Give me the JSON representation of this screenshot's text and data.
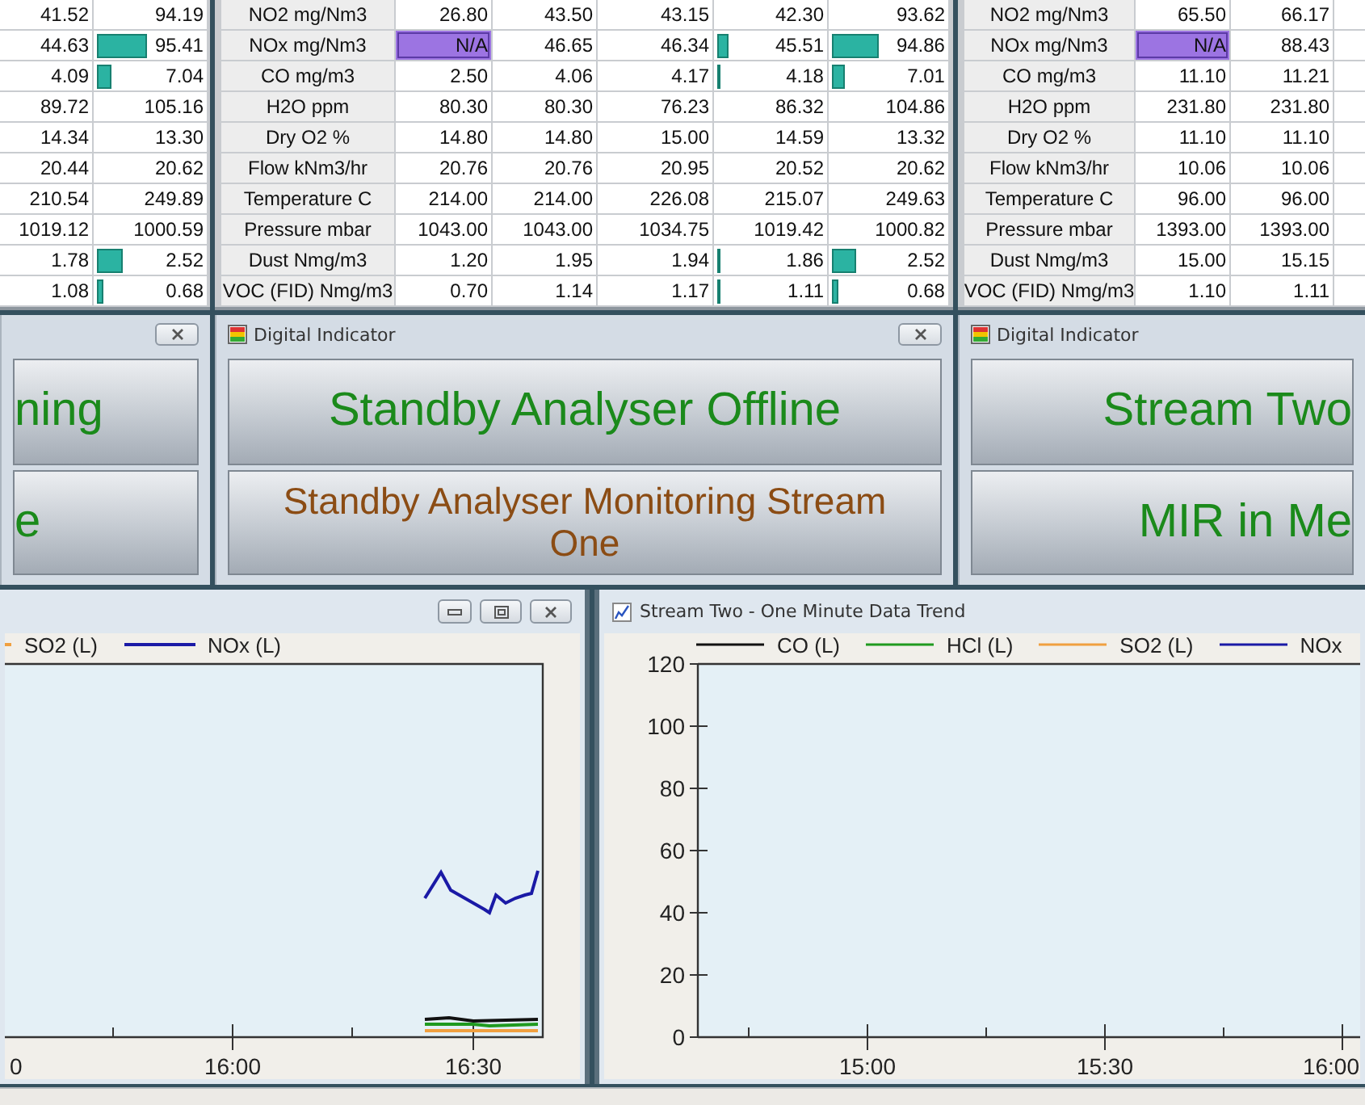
{
  "stream_tables": [
    {
      "rows": [
        {
          "cells": [
            {
              "text": "41.52",
              "flagged": false
            },
            {
              "text": "94.19",
              "flagged": false
            }
          ]
        },
        {
          "cells": [
            {
              "text": "44.63",
              "flagged": false
            },
            {
              "text": "95.41",
              "flagged": false,
              "level": 0.47
            }
          ]
        },
        {
          "cells": [
            {
              "text": "4.09",
              "flagged": false
            },
            {
              "text": "7.04",
              "flagged": false,
              "level": 0.13
            }
          ]
        },
        {
          "cells": [
            {
              "text": "89.72",
              "flagged": false
            },
            {
              "text": "105.16",
              "flagged": false
            }
          ]
        },
        {
          "cells": [
            {
              "text": "14.34",
              "flagged": false
            },
            {
              "text": "13.30",
              "flagged": false
            }
          ]
        },
        {
          "cells": [
            {
              "text": "20.44",
              "flagged": false
            },
            {
              "text": "20.62",
              "flagged": false
            }
          ]
        },
        {
          "cells": [
            {
              "text": "210.54",
              "flagged": false
            },
            {
              "text": "249.89",
              "flagged": false
            }
          ]
        },
        {
          "cells": [
            {
              "text": "1019.12",
              "flagged": false
            },
            {
              "text": "1000.59",
              "flagged": false
            }
          ]
        },
        {
          "cells": [
            {
              "text": "1.78",
              "flagged": false
            },
            {
              "text": "2.52",
              "flagged": false,
              "level": 0.24
            }
          ]
        },
        {
          "cells": [
            {
              "text": "1.08",
              "flagged": false
            },
            {
              "text": "0.68",
              "flagged": false,
              "level": 0.06
            }
          ]
        }
      ]
    },
    {
      "rows": [
        {
          "label": "NO2 mg/Nm3",
          "cells": [
            {
              "text": "26.80",
              "flagged": false
            },
            {
              "text": "43.50",
              "flagged": false
            },
            {
              "text": "43.15",
              "flagged": false
            },
            {
              "text": "42.30",
              "flagged": false
            },
            {
              "text": "93.62",
              "flagged": false
            }
          ]
        },
        {
          "label": "NOx mg/Nm3",
          "cells": [
            {
              "text": "N/A",
              "flagged": true
            },
            {
              "text": "46.65",
              "flagged": false
            },
            {
              "text": "46.34",
              "flagged": false
            },
            {
              "text": "45.51",
              "flagged": false,
              "level": 0.1
            },
            {
              "text": "94.86",
              "flagged": false,
              "level": 0.42
            }
          ]
        },
        {
          "label": "CO mg/m3",
          "cells": [
            {
              "text": "2.50",
              "flagged": false
            },
            {
              "text": "4.06",
              "flagged": false
            },
            {
              "text": "4.17",
              "flagged": false
            },
            {
              "text": "4.18",
              "flagged": false,
              "level": 0.03
            },
            {
              "text": "7.01",
              "flagged": false,
              "level": 0.11
            }
          ]
        },
        {
          "label": "H2O ppm",
          "cells": [
            {
              "text": "80.30",
              "flagged": false
            },
            {
              "text": "80.30",
              "flagged": false
            },
            {
              "text": "76.23",
              "flagged": false
            },
            {
              "text": "86.32",
              "flagged": false
            },
            {
              "text": "104.86",
              "flagged": false
            }
          ]
        },
        {
          "label": "Dry O2 %",
          "cells": [
            {
              "text": "14.80",
              "flagged": false
            },
            {
              "text": "14.80",
              "flagged": false
            },
            {
              "text": "15.00",
              "flagged": false
            },
            {
              "text": "14.59",
              "flagged": false
            },
            {
              "text": "13.32",
              "flagged": false
            }
          ]
        },
        {
          "label": "Flow kNm3/hr",
          "cells": [
            {
              "text": "20.76",
              "flagged": false
            },
            {
              "text": "20.76",
              "flagged": false
            },
            {
              "text": "20.95",
              "flagged": false
            },
            {
              "text": "20.52",
              "flagged": false
            },
            {
              "text": "20.62",
              "flagged": false
            }
          ]
        },
        {
          "label": "Temperature C",
          "cells": [
            {
              "text": "214.00",
              "flagged": false
            },
            {
              "text": "214.00",
              "flagged": false
            },
            {
              "text": "226.08",
              "flagged": false
            },
            {
              "text": "215.07",
              "flagged": false
            },
            {
              "text": "249.63",
              "flagged": false
            }
          ]
        },
        {
          "label": "Pressure mbar",
          "cells": [
            {
              "text": "1043.00",
              "flagged": false
            },
            {
              "text": "1043.00",
              "flagged": false
            },
            {
              "text": "1034.75",
              "flagged": false
            },
            {
              "text": "1019.42",
              "flagged": false
            },
            {
              "text": "1000.82",
              "flagged": false
            }
          ]
        },
        {
          "label": "Dust Nmg/m3",
          "cells": [
            {
              "text": "1.20",
              "flagged": false
            },
            {
              "text": "1.95",
              "flagged": false
            },
            {
              "text": "1.94",
              "flagged": false
            },
            {
              "text": "1.86",
              "flagged": false,
              "level": 0.03
            },
            {
              "text": "2.52",
              "flagged": false,
              "level": 0.22
            }
          ]
        },
        {
          "label": "VOC (FID) Nmg/m3",
          "cells": [
            {
              "text": "0.70",
              "flagged": false
            },
            {
              "text": "1.14",
              "flagged": false
            },
            {
              "text": "1.17",
              "flagged": false
            },
            {
              "text": "1.11",
              "flagged": false,
              "level": 0.03
            },
            {
              "text": "0.68",
              "flagged": false,
              "level": 0.05
            }
          ]
        }
      ]
    },
    {
      "rows": [
        {
          "label": "NO2 mg/Nm3",
          "cells": [
            {
              "text": "65.50",
              "flagged": false
            },
            {
              "text": "66.17",
              "flagged": false
            }
          ]
        },
        {
          "label": "NOx mg/Nm3",
          "cells": [
            {
              "text": "N/A",
              "flagged": true
            },
            {
              "text": "88.43",
              "flagged": false
            }
          ]
        },
        {
          "label": "CO mg/m3",
          "cells": [
            {
              "text": "11.10",
              "flagged": false
            },
            {
              "text": "11.21",
              "flagged": false
            }
          ]
        },
        {
          "label": "H2O ppm",
          "cells": [
            {
              "text": "231.80",
              "flagged": false
            },
            {
              "text": "231.80",
              "flagged": false
            }
          ]
        },
        {
          "label": "Dry O2 %",
          "cells": [
            {
              "text": "11.10",
              "flagged": false
            },
            {
              "text": "11.10",
              "flagged": false
            }
          ]
        },
        {
          "label": "Flow kNm3/hr",
          "cells": [
            {
              "text": "10.06",
              "flagged": false
            },
            {
              "text": "10.06",
              "flagged": false
            }
          ]
        },
        {
          "label": "Temperature C",
          "cells": [
            {
              "text": "96.00",
              "flagged": false
            },
            {
              "text": "96.00",
              "flagged": false
            }
          ]
        },
        {
          "label": "Pressure mbar",
          "cells": [
            {
              "text": "1393.00",
              "flagged": false
            },
            {
              "text": "1393.00",
              "flagged": false
            }
          ]
        },
        {
          "label": "Dust Nmg/m3",
          "cells": [
            {
              "text": "15.00",
              "flagged": false
            },
            {
              "text": "15.15",
              "flagged": false
            }
          ]
        },
        {
          "label": "VOC (FID) Nmg/m3",
          "cells": [
            {
              "text": "1.10",
              "flagged": false
            },
            {
              "text": "1.11",
              "flagged": false
            }
          ]
        }
      ]
    }
  ],
  "indicators": [
    {
      "lines": [
        {
          "text": "ning",
          "color": "#1b8a1b"
        },
        {
          "text": "e",
          "color": "#1b8a1b"
        }
      ]
    },
    {
      "title": "Digital Indicator",
      "lines": [
        {
          "text": "Standby Analyser Offline",
          "color": "#1b8a1b"
        },
        {
          "text": "Standby Analyser Monitoring Stream One",
          "color": "#8b4c14"
        }
      ]
    },
    {
      "title": "Digital Indicator",
      "lines": [
        {
          "text": "Stream Two",
          "color": "#1b8a1b"
        },
        {
          "text": "MIR in Me",
          "color": "#1b8a1b"
        }
      ]
    }
  ],
  "trend_windows": [
    {
      "legend": [
        {
          "label": "SO2 (L)",
          "color": "#f0a040"
        },
        {
          "label": "NOx (L)",
          "color": "#1a1aa6"
        }
      ],
      "x_labels": [
        "0",
        "16:00",
        "16:30"
      ]
    },
    {
      "title": "Stream Two - One Minute Data Trend",
      "chart_data": {
        "type": "line",
        "categories": [
          "15:00",
          "15:30",
          "16:00"
        ],
        "ylim": [
          0,
          120
        ],
        "yticks": [
          0,
          20,
          40,
          60,
          80,
          100,
          120
        ],
        "series": [
          {
            "name": "CO (L)",
            "color": "#111111",
            "values": [
              null,
              null,
              null
            ]
          },
          {
            "name": "HCl (L)",
            "color": "#1f9a1f",
            "values": [
              null,
              null,
              null
            ]
          },
          {
            "name": "SO2 (L)",
            "color": "#f0a040",
            "values": [
              null,
              null,
              null
            ]
          },
          {
            "name": "NOx",
            "color": "#1a1aa6",
            "values": [
              null,
              null,
              null
            ]
          }
        ]
      }
    }
  ]
}
